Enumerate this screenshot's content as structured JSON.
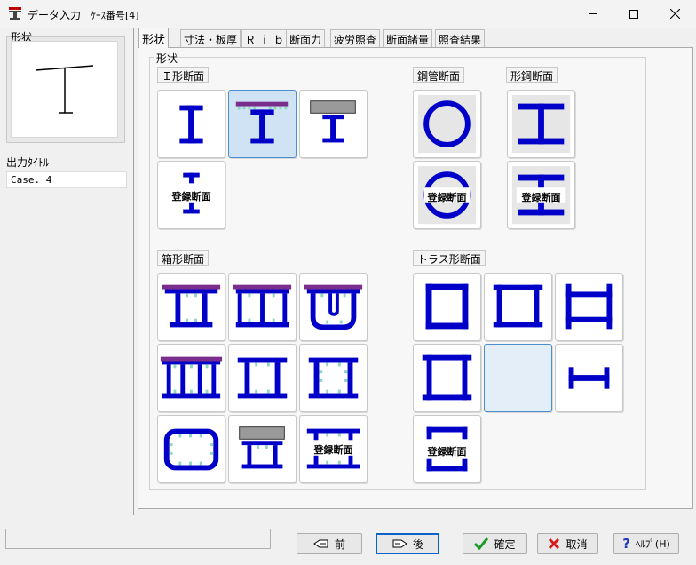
{
  "window": {
    "title": "データ入力",
    "case_label": "ｹｰｽ番号[4]"
  },
  "left": {
    "preview_label": "形状",
    "output_title_label": "出力ﾀｲﾄﾙ",
    "output_title_value": "Case.  4"
  },
  "tabs": [
    {
      "label": "形状",
      "active": true
    },
    {
      "label": "寸法・板厚"
    },
    {
      "label": "Ｒｉｂ"
    },
    {
      "label": "断面力"
    },
    {
      "label": "疲労照査"
    },
    {
      "label": "断面諸量"
    },
    {
      "label": "照査結果"
    }
  ],
  "group_label": "形状",
  "sections": {
    "i_section": "Ｉ形断面",
    "pipe_section": "鋼管断面",
    "shape_section": "形鋼断面",
    "box_section": "箱形断面",
    "truss_section": "トラス形断面"
  },
  "tile_text": {
    "registered": "登録断面"
  },
  "buttons": {
    "prev": "前",
    "next": "後",
    "ok": "確定",
    "cancel": "取消",
    "help": "ﾍﾙﾌﾟ(H)"
  },
  "colors": {
    "steel": "#0000c8",
    "deck": "#7a2d8c",
    "concrete": "#9a9a9a",
    "rib": "#8fd8c0",
    "selected": "#cfe3f5"
  }
}
